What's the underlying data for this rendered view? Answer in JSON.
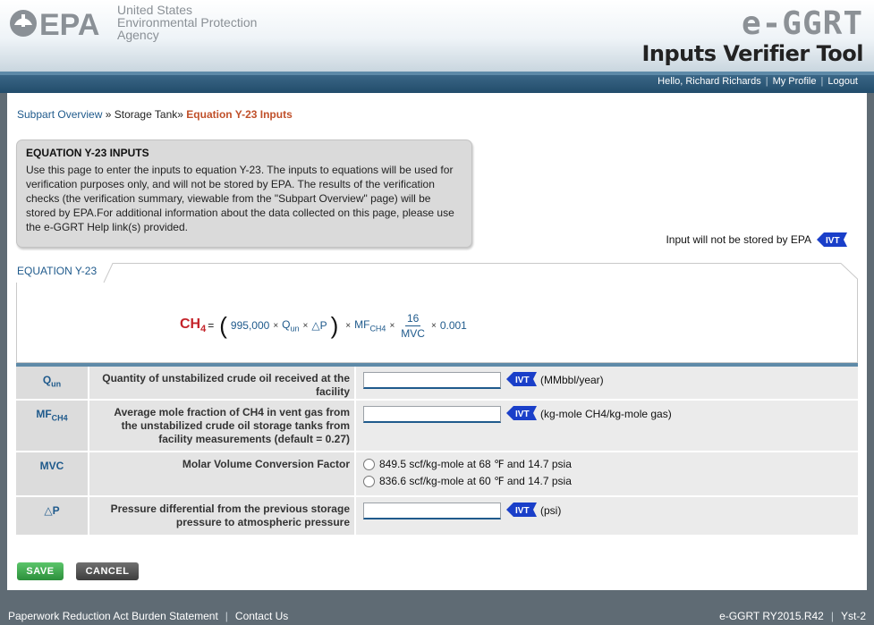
{
  "header": {
    "agency_line1": "United States",
    "agency_line2": "Environmental Protection",
    "agency_line3": "Agency",
    "logo_text": "EPA",
    "app_title": "e-GGRT",
    "tool_title": "Inputs Verifier Tool"
  },
  "usernav": {
    "greeting": "Hello, Richard Richards",
    "profile": "My Profile",
    "logout": "Logout"
  },
  "breadcrumb": {
    "item1": "Subpart Overview",
    "sep": "»",
    "item2": "Storage Tank",
    "current": "Equation Y-23 Inputs"
  },
  "info": {
    "title": "EQUATION Y-23 INPUTS",
    "text": "Use this page to enter the inputs to equation Y-23. The inputs to equations will be used for verification purposes only, and will not be stored by EPA. The results of the verification checks (the verification summary, viewable from the \"Subpart Overview\" page) will be stored by EPA.For additional information about the data collected on this page, please use the e-GGRT Help link(s) provided."
  },
  "not_stored": "Input will not be stored by EPA",
  "ivt_label": "IVT",
  "equation": {
    "panel_label": "EQUATION Y-23",
    "lhs": "CH",
    "lhs_sub": "4",
    "equals": "=",
    "coef": "995,000",
    "times": "×",
    "q": "Q",
    "q_sub": "un",
    "dp": "△P",
    "mf": "MF",
    "mf_sub": "CH4",
    "frac_num": "16",
    "frac_den": "MVC",
    "factor": "0.001"
  },
  "rows": [
    {
      "sym": "Q",
      "sym_sub": "un",
      "desc": "Quantity of unstabilized crude oil received at the facility",
      "value": "",
      "unit": "(MMbbl/year)"
    },
    {
      "sym": "MF",
      "sym_sub": "CH4",
      "desc": "Average mole fraction of CH4 in vent gas from the unstabilized crude oil storage tanks from facility measurements (default = 0.27)",
      "value": "",
      "unit": "(kg-mole CH4/kg-mole gas)"
    },
    {
      "sym": "MVC",
      "desc": "Molar Volume Conversion Factor",
      "options": [
        "849.5 scf/kg-mole at 68 ℉ and 14.7 psia",
        "836.6 scf/kg-mole at 60 ℉ and 14.7 psia"
      ]
    },
    {
      "sym": "△P",
      "desc": "Pressure differential from the previous storage pressure to atmospheric pressure",
      "value": "",
      "unit": "(psi)"
    }
  ],
  "buttons": {
    "save": "SAVE",
    "cancel": "CANCEL"
  },
  "footer": {
    "burden": "Paperwork Reduction Act Burden Statement",
    "contact": "Contact Us",
    "version": "e-GGRT RY2015.R42",
    "server": "Yst-2"
  },
  "colors": {
    "link": "#1f5a8c",
    "accent_red": "#c4232a",
    "current_crumb": "#c0502a",
    "nav_blue": "#224c6b",
    "save_green": "#2c8f3b"
  }
}
